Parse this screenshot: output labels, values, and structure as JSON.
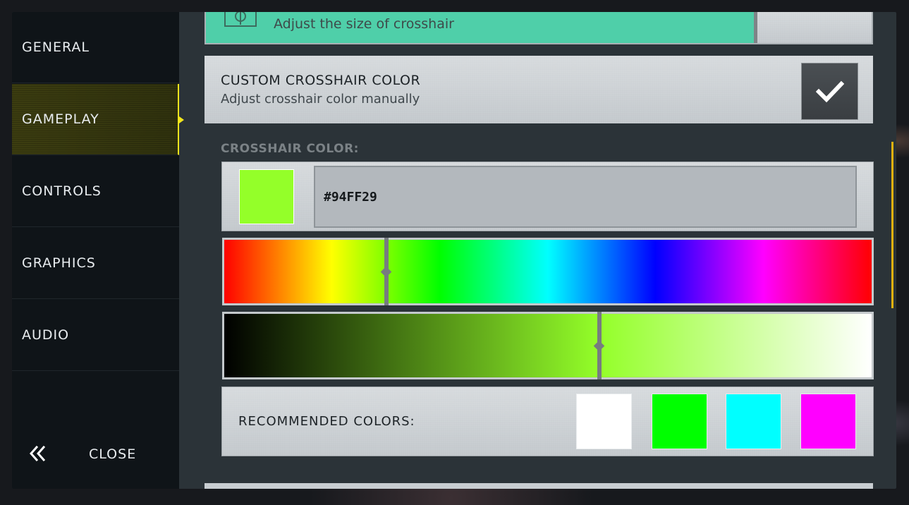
{
  "sidebar": {
    "items": [
      {
        "label": "GENERAL"
      },
      {
        "label": "GAMEPLAY"
      },
      {
        "label": "CONTROLS"
      },
      {
        "label": "GRAPHICS"
      },
      {
        "label": "AUDIO"
      }
    ],
    "active_item": "GAMEPLAY",
    "close_label": "CLOSE",
    "close_icon": "double-chevron-left-icon"
  },
  "crosshair_size": {
    "description": "Adjust the size of crosshair",
    "icon": "crosshair-icon",
    "fill_color": "#4fcfa9"
  },
  "custom_color": {
    "title": "CUSTOM CROSSHAIR COLOR",
    "description": "Adjust crosshair color manually",
    "checked": true
  },
  "crosshair_color": {
    "section_label": "CROSSHAIR COLOR:",
    "hex_value": "#94FF29",
    "swatch_color": "#94FF29",
    "hue_level": 0.25,
    "shade_level": 0.58
  },
  "recommended": {
    "label": "RECOMMENDED COLORS:",
    "colors": [
      "#FFFFFF",
      "#00FF00",
      "#00FFFF",
      "#FF00FF"
    ]
  },
  "accent_color": "#f1e51c"
}
